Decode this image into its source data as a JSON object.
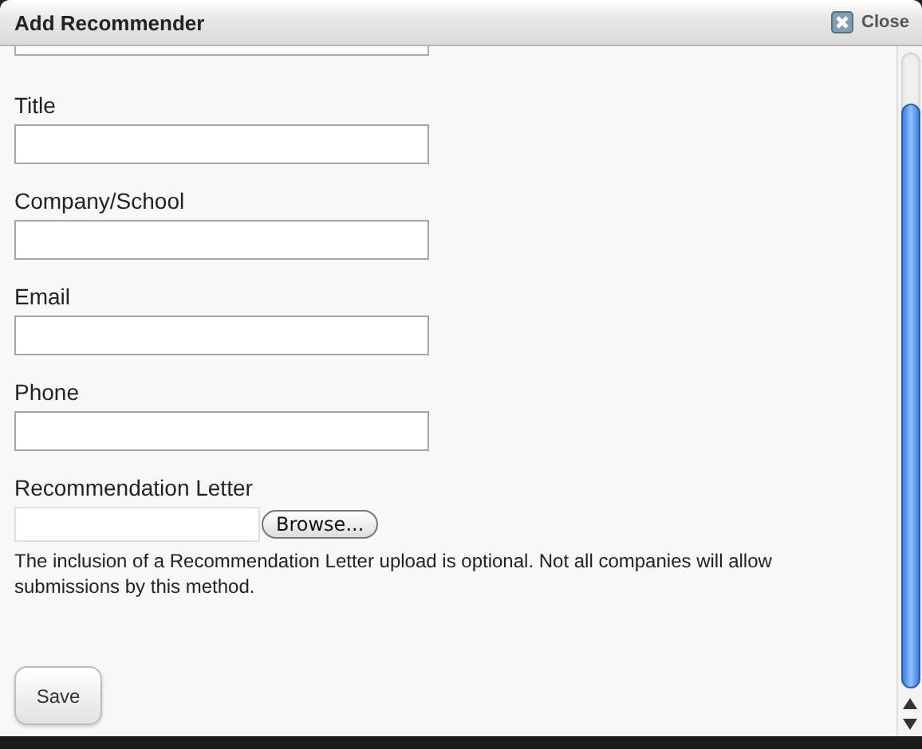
{
  "window": {
    "title": "Add Recommender",
    "close_label": "Close"
  },
  "fields": [
    {
      "label": "Title"
    },
    {
      "label": "Company/School"
    },
    {
      "label": "Email"
    },
    {
      "label": "Phone"
    }
  ],
  "upload": {
    "label": "Recommendation Letter",
    "button": "Browse...",
    "note": "The inclusion of a Recommendation Letter upload is optional. Not all companies will allow submissions by this method."
  },
  "save_button": "Save"
}
